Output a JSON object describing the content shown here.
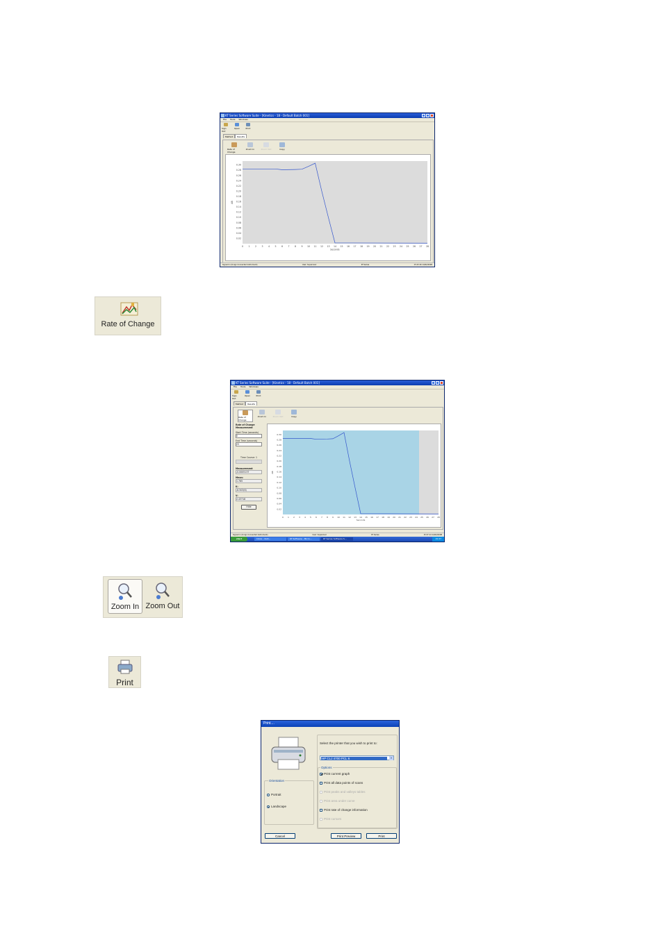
{
  "screenshot1": {
    "window_title": "KT Series Software Suite - [Kinetics - 18 - Default Batch 001]",
    "menu": [
      "File",
      "Tools",
      "Windows"
    ],
    "toolbar": [
      "Sign Out",
      "Open",
      "Print"
    ],
    "tabs": [
      "Method",
      "Results"
    ],
    "subtoolbar": [
      "Rate of Change",
      "Zoom In",
      "Zoom Out",
      "Copy"
    ],
    "y_ticks": [
      "0.30",
      "0.28",
      "0.26",
      "0.24",
      "0.22",
      "0.20",
      "0.18",
      "0.16",
      "0.14",
      "0.12",
      "0.10",
      "0.08",
      "0.06",
      "0.04",
      "0.02"
    ],
    "x_ticks": [
      "0",
      "1",
      "2",
      "3",
      "4",
      "5",
      "6",
      "7",
      "8",
      "9",
      "10",
      "11",
      "12",
      "13",
      "14",
      "15",
      "16",
      "17",
      "18",
      "19",
      "20",
      "21",
      "22",
      "23",
      "24",
      "25",
      "26",
      "27",
      "28"
    ],
    "x_label": "Seconds",
    "y_label": "AB",
    "status": [
      "Signed in (Unigo Connected Instrument)",
      "User: Supervisor",
      "KT Series",
      "15:23:16 14/02/2008"
    ]
  },
  "callout_rate": {
    "label": "Rate of Change"
  },
  "screenshot2": {
    "window_title": "KT Series Software Suite - [Kinetics - 18 - Default Batch 001]",
    "menu": [
      "File",
      "Tools",
      "Windows"
    ],
    "toolbar": [
      "Sign Out",
      "Open",
      "Print"
    ],
    "tabs": [
      "Method",
      "Results"
    ],
    "subtoolbar": [
      "Rate of Change",
      "Zoom In",
      "Zoom Out",
      "Copy"
    ],
    "side_panel": {
      "heading": "Rate of Change Measurement",
      "start_label": "Start Time (seconds)",
      "start_value": "0",
      "end_label": "End Time (seconds)",
      "end_value": "25",
      "time_course_label": "Time Course: 1",
      "measurement_label": "Measurement",
      "measurement_value": "-0.0005137",
      "mean_label": "Mean:",
      "mean_value": "1.765",
      "k_label": "K:",
      "k_value": "-8.503(6)",
      "v_label": "V:",
      "v_value": "2.43718",
      "hide_label": "Hide"
    },
    "status": [
      "Signed in (Unigo Connected Instrument)",
      "User: Supervisor",
      "KT Series",
      "15:37:14 14/02/2008"
    ],
    "taskbar": {
      "start": "start",
      "items": [
        "Inbox - Outl...",
        "KT Software - Micro...",
        "KT Series Software S..."
      ],
      "clock": "15:37"
    }
  },
  "callout_zoom": {
    "zoom_in": "Zoom In",
    "zoom_out": "Zoom Out"
  },
  "callout_print": {
    "label": "Print"
  },
  "print_dialog": {
    "title": "Print....",
    "select_prompt": "Select the printer that you wish to print to:",
    "printer": "HP CLJ 4700 PCL 6",
    "options_label": "Options",
    "options": [
      {
        "label": "Print current graph",
        "checked": true,
        "enabled": true
      },
      {
        "label": "Print all data points of scans",
        "checked": false,
        "enabled": true
      },
      {
        "label": "Print peaks and valleys tables",
        "checked": false,
        "enabled": false
      },
      {
        "label": "Print area under curve",
        "checked": false,
        "enabled": false
      },
      {
        "label": "Print rate of change information",
        "checked": false,
        "enabled": true
      },
      {
        "label": "Print cursors",
        "checked": false,
        "enabled": false
      }
    ],
    "orientation_label": "Orientation",
    "portrait": "Portrait",
    "landscape": "Landscape",
    "cancel": "Cancel",
    "print_preview": "Print Preview",
    "print": "Print"
  },
  "colors": {
    "plot_grey": "#dcdcdc",
    "selection_blue": "#a9d4e6",
    "line": "#3355cc",
    "xp_title": "#0a3cb0"
  }
}
